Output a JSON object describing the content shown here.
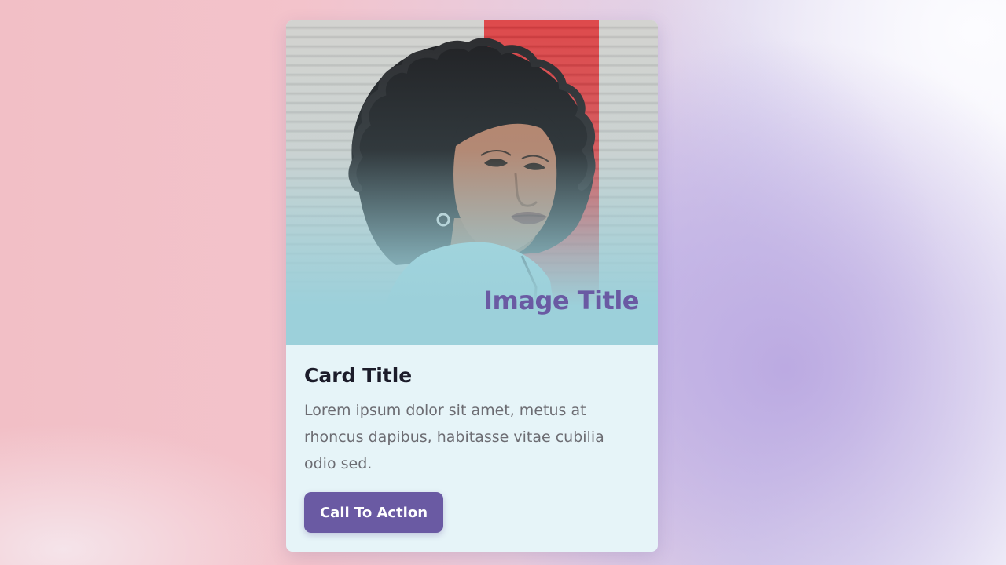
{
  "card": {
    "image": {
      "title": "Image Title",
      "alt": "portrait of a woman with curly hair in front of a shutter wall"
    },
    "title": "Card Title",
    "text": "Lorem ipsum dolor sit amet, metus at rhoncus dapibus, habitasse vitae cubilia odio sed.",
    "cta_label": "Call To Action"
  },
  "colors": {
    "accent": "#6a5aa3",
    "card_background": "#e6f4f8",
    "title_text": "#1c1c2a",
    "body_text": "#6c6c72"
  }
}
